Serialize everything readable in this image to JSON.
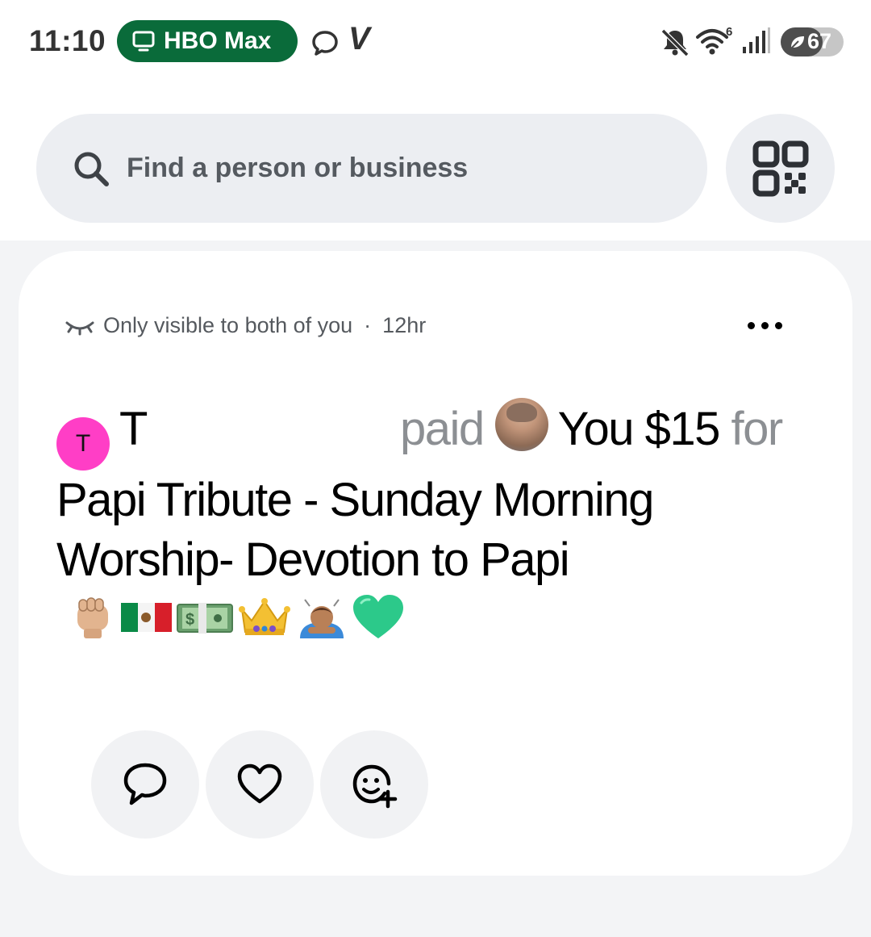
{
  "status_bar": {
    "time": "11:10",
    "media_pill": {
      "label": "HBO Max",
      "color": "#0a6b3a",
      "icon": "tv-icon"
    },
    "wifi_badge": "6",
    "battery_level": "67",
    "battery_percent": 67,
    "icons": [
      "chat-bubble-icon",
      "venmo-v-icon",
      "mute-icon",
      "wifi-icon",
      "signal-icon",
      "battery-icon"
    ]
  },
  "search": {
    "placeholder": "Find a person or business",
    "icon": "search-icon",
    "qr_icon": "qr-code-icon"
  },
  "post": {
    "visibility": "Only visible to both of you",
    "separator": "·",
    "time_ago": "12hr",
    "sender_initial": "T",
    "sender_name": "T",
    "verb": "paid",
    "recipient": "You",
    "amount": "$15",
    "for_word": "for",
    "note": "Papi Tribute - Sunday Morning Worship- Devotion to Papi",
    "note_emojis": [
      "raised-fist",
      "mexico-flag",
      "money-bills",
      "crown",
      "bowing-person",
      "green-heart"
    ],
    "avatar_color": "#ff3ec6"
  },
  "actions": [
    {
      "name": "comment",
      "icon": "comment-icon"
    },
    {
      "name": "like",
      "icon": "heart-icon"
    },
    {
      "name": "react",
      "icon": "add-reaction-icon"
    }
  ]
}
